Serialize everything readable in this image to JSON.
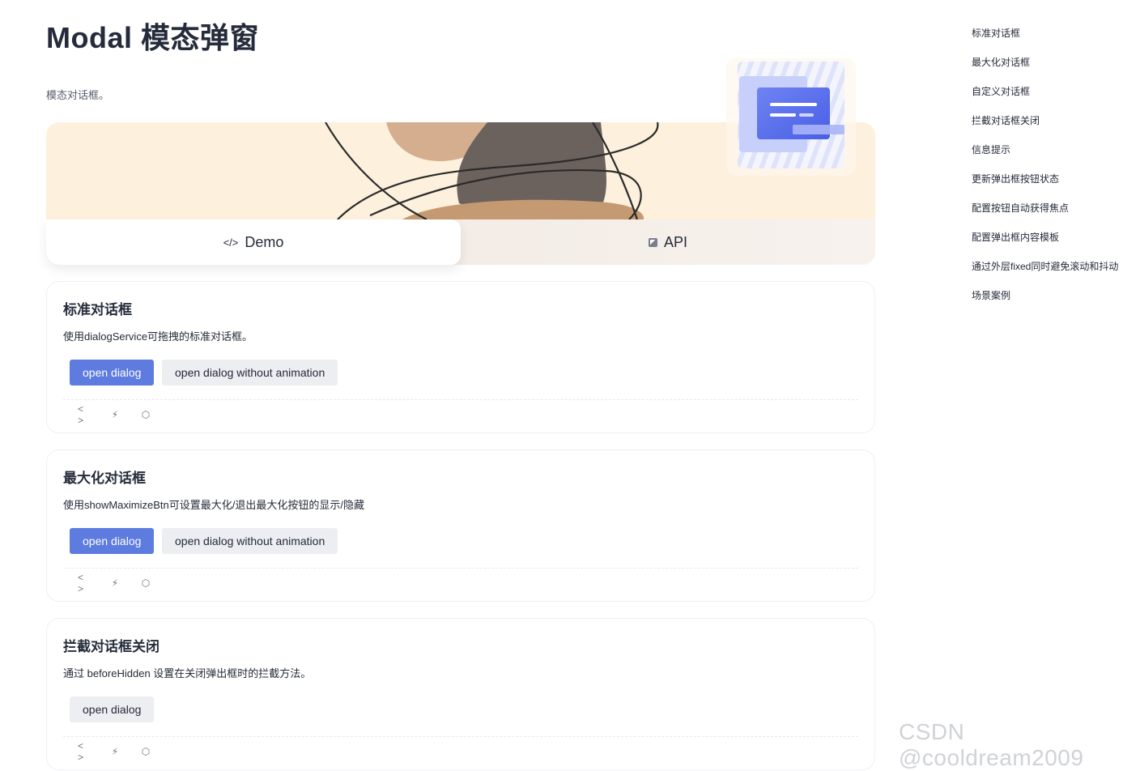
{
  "page": {
    "title": "Modal 模态弹窗",
    "description": "模态对话框。"
  },
  "tabs": [
    {
      "label": "Demo",
      "icon": "code-icon",
      "active": true
    },
    {
      "label": "API",
      "icon": "api-icon",
      "active": false
    }
  ],
  "demos": [
    {
      "title": "标准对话框",
      "description": "使用dialogService可拖拽的标准对话框。",
      "buttons": [
        {
          "label": "open dialog",
          "variant": "primary"
        },
        {
          "label": "open dialog without animation",
          "variant": "default"
        }
      ]
    },
    {
      "title": "最大化对话框",
      "description": "使用showMaximizeBtn可设置最大化/退出最大化按钮的显示/隐藏",
      "buttons": [
        {
          "label": "open dialog",
          "variant": "primary"
        },
        {
          "label": "open dialog without animation",
          "variant": "default"
        }
      ]
    },
    {
      "title": "拦截对话框关闭",
      "description": "通过 beforeHidden 设置在关闭弹出框时的拦截方法。",
      "buttons": [
        {
          "label": "open dialog",
          "variant": "default"
        }
      ]
    }
  ],
  "demo_tools": [
    "code-icon",
    "lightning-icon",
    "cube-icon"
  ],
  "toc": [
    "标准对话框",
    "最大化对话框",
    "自定义对话框",
    "拦截对话框关闭",
    "信息提示",
    "更新弹出框按钮状态",
    "配置按钮自动获得焦点",
    "配置弹出框内容模板",
    "通过外层fixed同时避免滚动和抖动",
    "场景案例"
  ],
  "watermark": "CSDN @cooldream2009",
  "colors": {
    "primary": "#5e7ce0",
    "text": "#252b3a",
    "hero_bg": "#fdf0dc",
    "button_default_bg": "#eceef2"
  }
}
